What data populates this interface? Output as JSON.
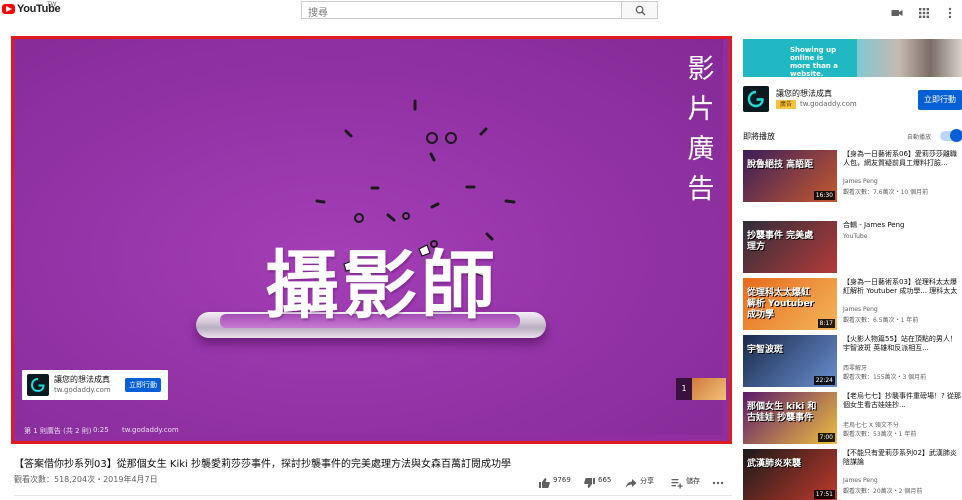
{
  "masthead": {
    "logo_text": "YouTube",
    "logo_region": "TW",
    "search_placeholder": "搜尋"
  },
  "player": {
    "video_overlay_title": "攝影師",
    "ad_vertical_text": "影片廣告",
    "ad_card": {
      "title": "讓您的想法成真",
      "url": "tw.godaddy.com",
      "cta": "立即行動"
    },
    "ad_info": "第 1 則廣告 (共 2 則)",
    "ad_time": "0:25",
    "ad_domain": "tw.godaddy.com",
    "next_count": "1"
  },
  "watch": {
    "title": "【答案借你抄系列03】從那個女生 Kiki 抄襲愛莉莎莎事件，探討抄襲事件的完美處理方法與女森百萬訂閱成功學",
    "views": "觀看次數：518,204次・2019年4月7日",
    "like_count": "9769",
    "dislike_count": "665",
    "share_label": "分享",
    "save_label": "儲存"
  },
  "sidebar": {
    "banner_text": "Showing up online is more than a website.",
    "sponsor": {
      "title": "讓您的想法成真",
      "badge": "廣告",
      "url": "tw.godaddy.com",
      "cta": "立即行動"
    },
    "upnext_label": "即將播放",
    "autoplay_label": "自動播放",
    "autoplay_on": true,
    "recommendations": [
      {
        "title": "【身為一日藝術系06】愛莉莎莎離職人包，網友質疑前員工爆料打臉...",
        "channel": "James Peng",
        "meta": "觀看次數：7.6萬次・10 個月前",
        "duration": "16:30",
        "thumb_text": "脫魯絕技 高語距",
        "thumb_colors": [
          "#3a1d5a",
          "#c55a2e"
        ]
      },
      {
        "title": "合輯 - James Peng",
        "channel": "YouTube",
        "meta": "",
        "duration": "",
        "thumb_text": "抄襲事件 完美處理方",
        "thumb_colors": [
          "#2e2e3a",
          "#b43a3a"
        ]
      },
      {
        "title": "【身為一日藝術系03】從理科太太爆紅解析 Youtuber 成功學... 理科太太",
        "channel": "James Peng",
        "meta": "觀看次數：6.5萬次・1 年前",
        "duration": "8:17",
        "thumb_text": "從理科太太爆紅 解析 Youtuber 成功學",
        "thumb_colors": [
          "#e86a1d",
          "#f2b65b"
        ]
      },
      {
        "title": "【火影人物篇55】站在頂點的男人！宇智波斑 英雄和反派相互...",
        "channel": "西零解牙",
        "meta": "觀看次數：155萬次・3 個月前",
        "duration": "22:24",
        "thumb_text": "宇智波斑",
        "thumb_colors": [
          "#1a2a4a",
          "#6a8fd0"
        ]
      },
      {
        "title": "【老烏七七】抄襲事件重磅場！? 從那個女生看古娃娃抄...",
        "channel": "老烏七七 X 領文不分",
        "meta": "觀看次數：53萬次・1 年前",
        "duration": "7:00",
        "thumb_text": "那個女生 kiki 和 古娃娃 抄襲事件",
        "thumb_colors": [
          "#5a1a6a",
          "#f0c040"
        ]
      },
      {
        "title": "【不能只有愛莉莎系列02】武漢肺炎陰謀論",
        "channel": "James Peng",
        "meta": "觀看次數：20萬次・2 個月前",
        "duration": "17:51",
        "thumb_text": "武漢肺炎來襲",
        "thumb_colors": [
          "#1a1a1a",
          "#c0392b"
        ]
      }
    ]
  },
  "colors": {
    "accent_blue": "#065fd4",
    "player_border": "#e01a1f",
    "video_purple": "#9534a8",
    "youtube_red": "#ff0000"
  }
}
